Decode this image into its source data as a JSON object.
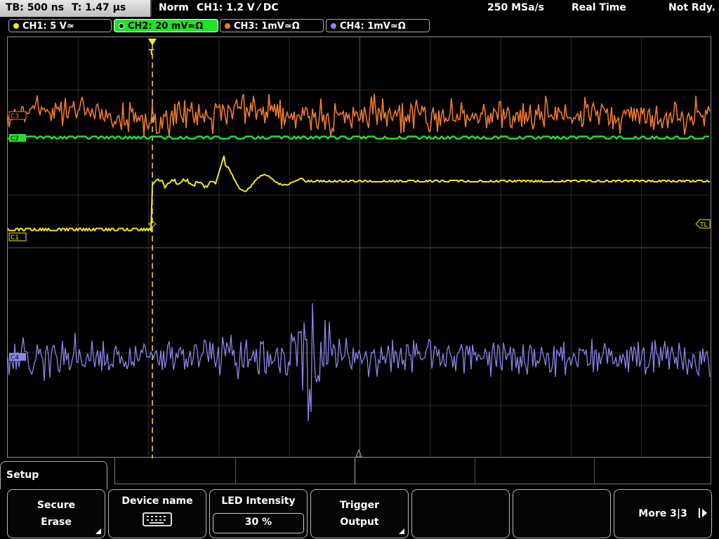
{
  "status": {
    "timebase": "TB: 500 ns",
    "trigger_time": "T: 1.47 µs",
    "mode": "Norm",
    "trigger_setting": "CH1: 1.2 V ⁄ DC",
    "sample_rate": "250 MSa/s",
    "acq_mode": "Real Time",
    "state": "Not Rdy."
  },
  "channels": [
    {
      "label": "CH1: 5 V≃",
      "color": "#f2ea1c",
      "active": false
    },
    {
      "label": "CH2: 20 mV≃Ω",
      "color": "#25e02a",
      "active": true
    },
    {
      "label": "CH3: 1mV≃Ω",
      "color": "#f07a2a",
      "active": false
    },
    {
      "label": "CH4: 1mV≃Ω",
      "color": "#8a86ea",
      "active": false
    }
  ],
  "markers": {
    "c3": "C3",
    "c2": "C2",
    "c1": "C1",
    "c4": "C4",
    "trigger_level": "TL",
    "trigger_pos": "T"
  },
  "waveforms": {
    "ch3_color": "#f07a2a",
    "ch2_color": "#25e02a",
    "ch1_color": "#f2ea1c",
    "ch4_color": "#8a86ea"
  },
  "menu": {
    "title": "Setup",
    "softkeys": [
      {
        "line1": "Secure",
        "line2": "Erase"
      },
      {
        "line1": "Device name",
        "icon": "keyboard-icon"
      },
      {
        "line1": "LED Intensity",
        "value": "30 %"
      },
      {
        "line1": "Trigger",
        "line2": "Output"
      },
      {
        "line1": ""
      },
      {
        "line1": ""
      },
      {
        "line1": "More 3|3"
      }
    ]
  }
}
